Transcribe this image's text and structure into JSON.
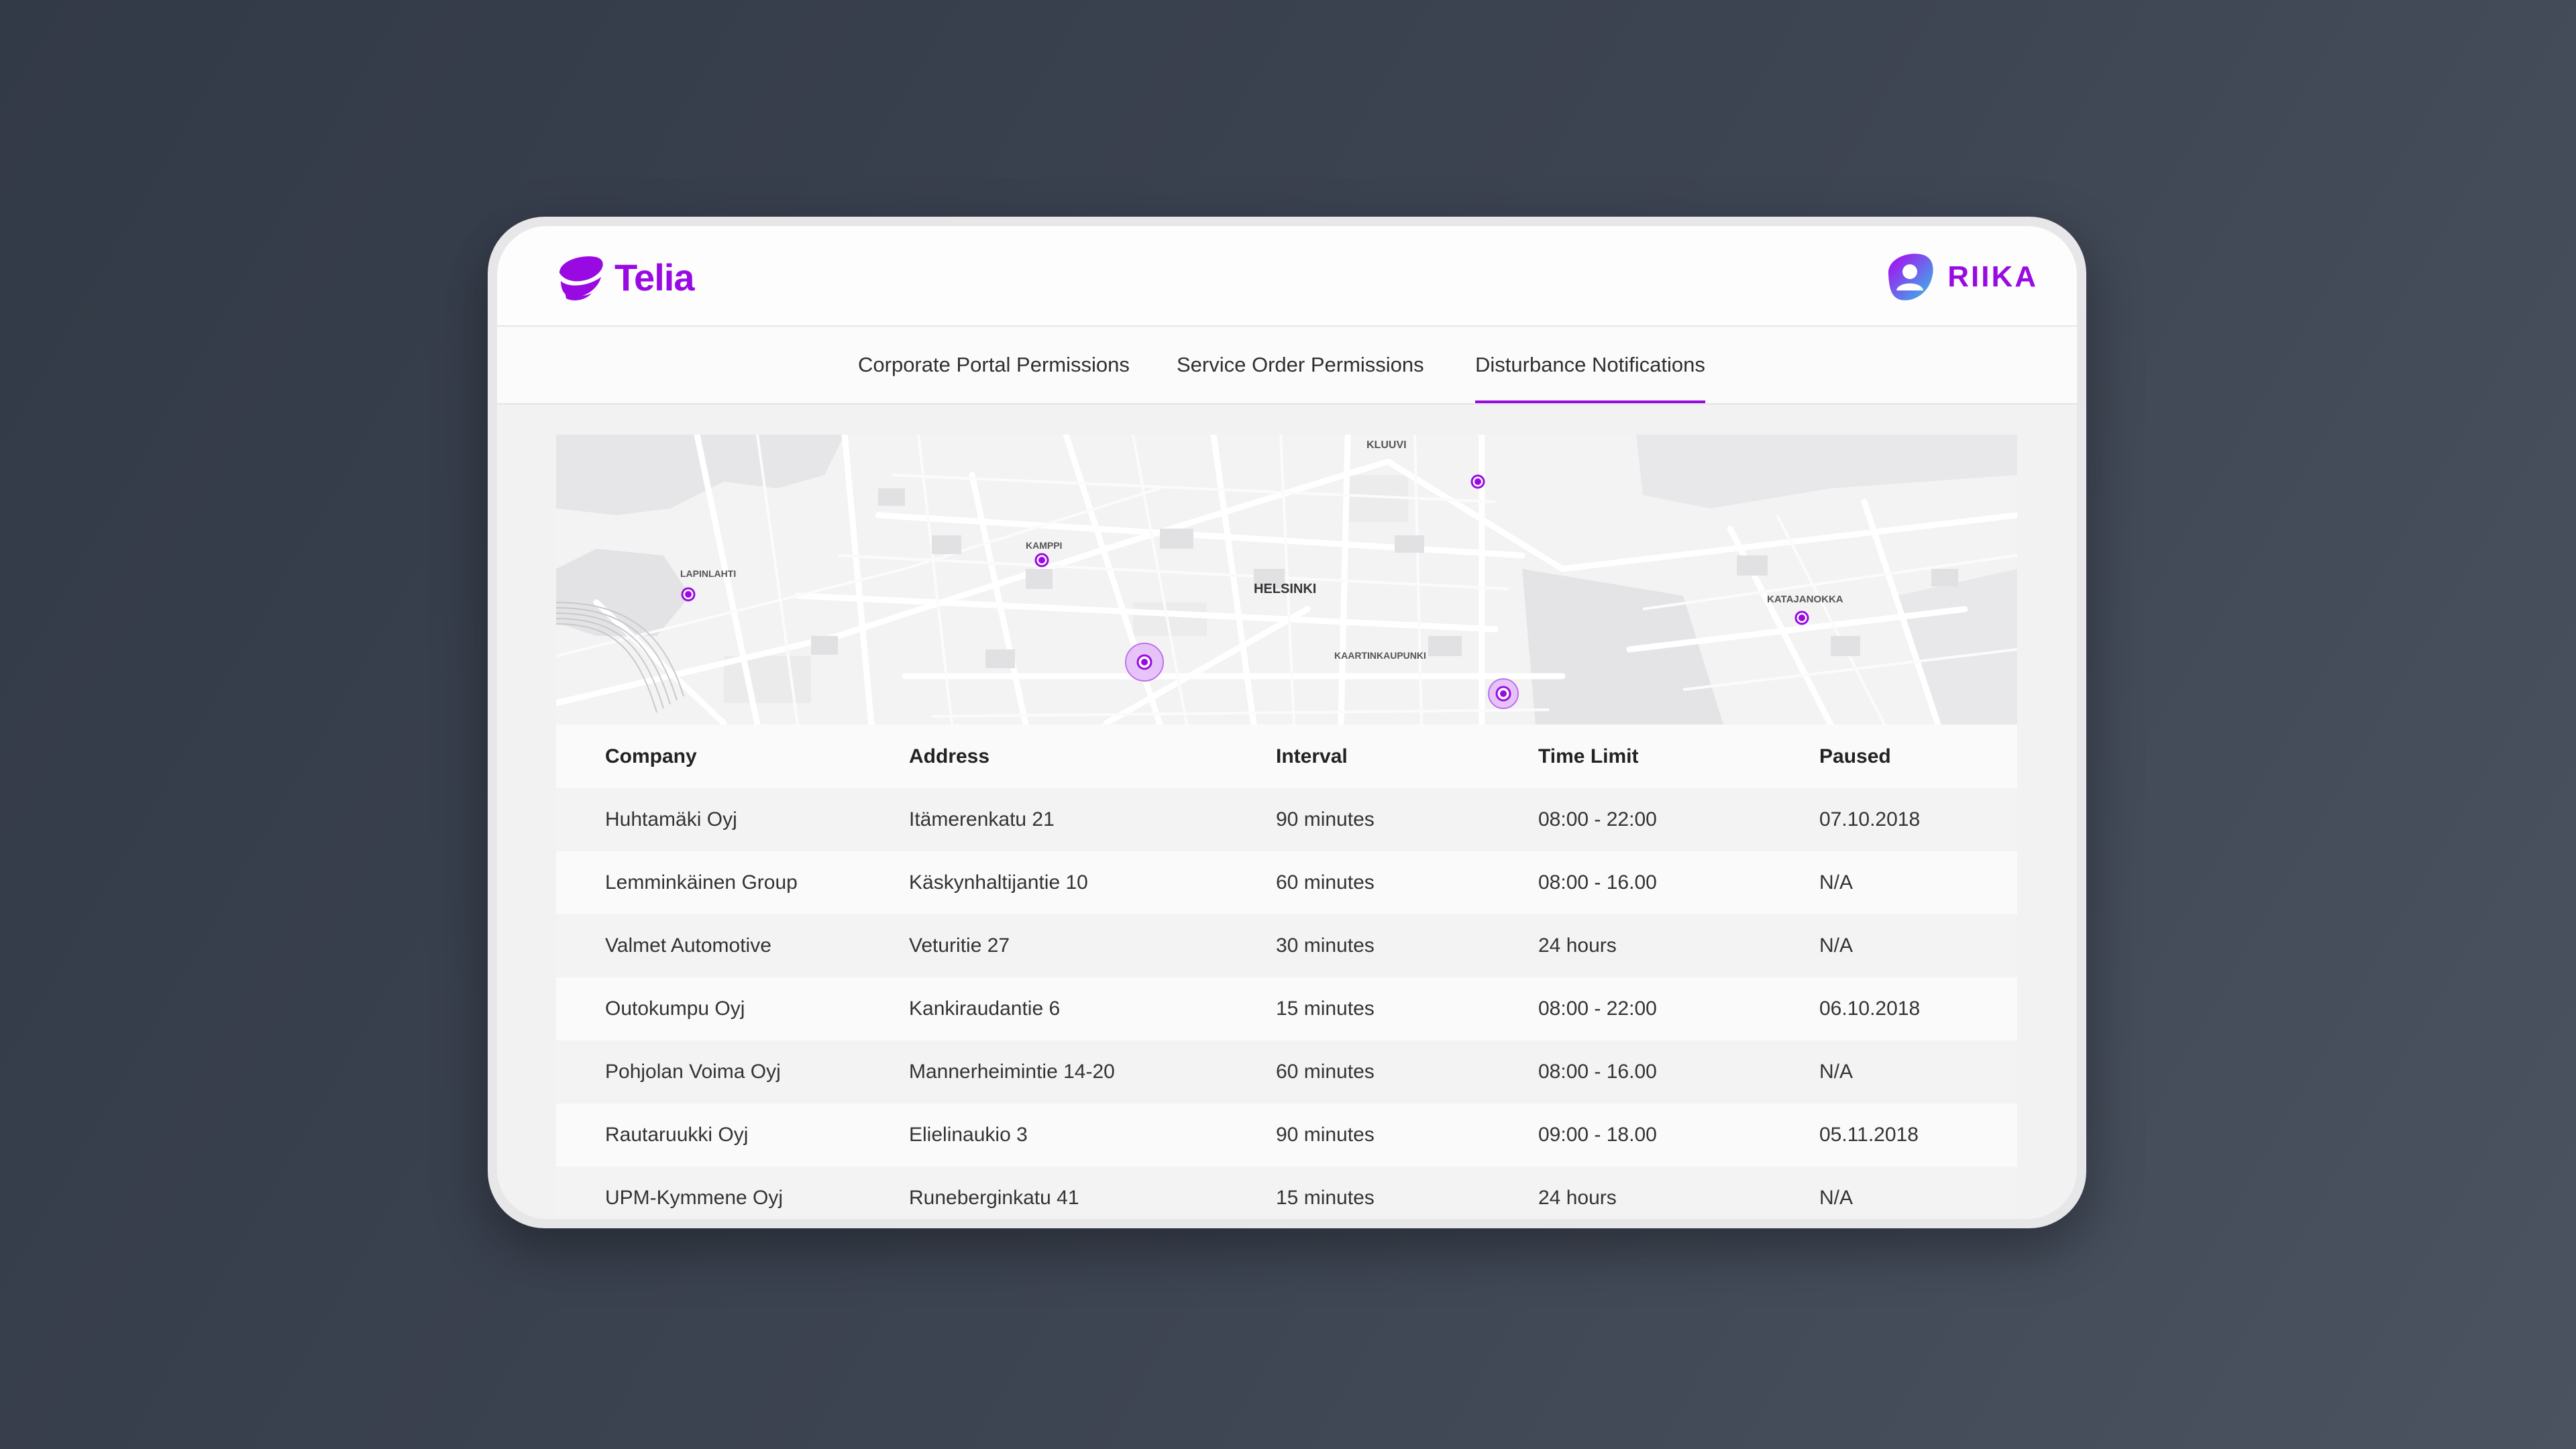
{
  "brand": {
    "telia_name": "Telia",
    "riika_name": "RIIKA",
    "accent": "#990ae3",
    "riika_gradient": [
      "#b100f0",
      "#2fc3e8"
    ]
  },
  "tabs": [
    {
      "label": "Corporate Portal Permissions",
      "active": false
    },
    {
      "label": "Service Order Permissions",
      "active": false
    },
    {
      "label": "Disturbance Notifications",
      "active": true
    }
  ],
  "map": {
    "labels": [
      "KLUUVI",
      "LAPINLAHTI",
      "KAMPPI",
      "HELSINKI",
      "KATAJANOKKA",
      "KAARTINKAUPUNKI"
    ],
    "marker_icon": "location-pin-icon"
  },
  "table": {
    "headers": [
      "Company",
      "Address",
      "Interval",
      "Time Limit",
      "Paused"
    ],
    "rows": [
      [
        "Huhtamäki Oyj",
        "Itämerenkatu 21",
        "90 minutes",
        "08:00 - 22:00",
        "07.10.2018"
      ],
      [
        "Lemminkäinen Group",
        "Käskynhaltijantie 10",
        "60 minutes",
        "08:00 - 16.00",
        "N/A"
      ],
      [
        "Valmet Automotive",
        "Veturitie 27",
        "30 minutes",
        "24 hours",
        "N/A"
      ],
      [
        "Outokumpu Oyj",
        "Kankiraudantie 6",
        "15 minutes",
        "08:00 - 22:00",
        "06.10.2018"
      ],
      [
        "Pohjolan Voima Oyj",
        "Mannerheimintie 14-20",
        "60 minutes",
        "08:00 - 16.00",
        "N/A"
      ],
      [
        "Rautaruukki Oyj",
        "Elielinaukio 3",
        "90 minutes",
        "09:00 - 18.00",
        "05.11.2018"
      ],
      [
        "UPM-Kymmene Oyj",
        "Runeberginkatu 41",
        "15 minutes",
        "24 hours",
        "N/A"
      ]
    ]
  }
}
